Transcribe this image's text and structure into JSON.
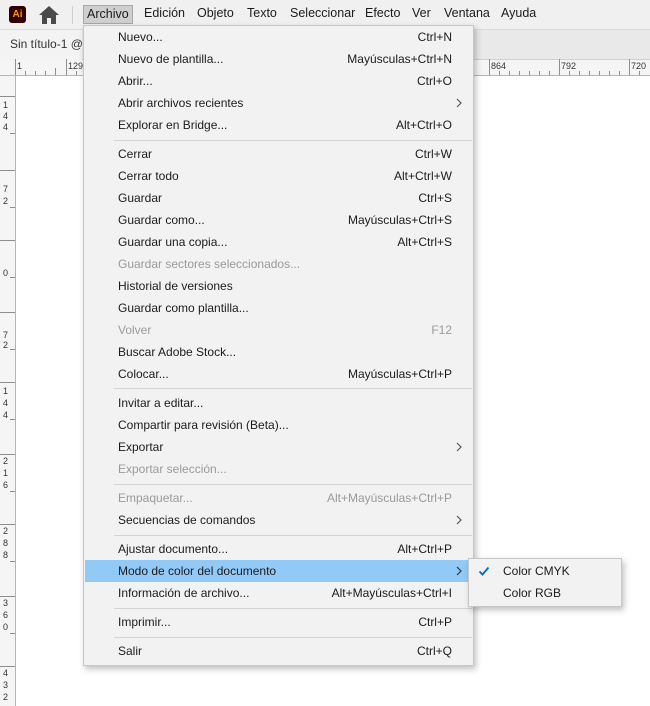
{
  "app": {
    "logo_text": "Ai"
  },
  "menubar": {
    "items": [
      "Archivo",
      "Edición",
      "Objeto",
      "Texto",
      "Seleccionar",
      "Efecto",
      "Ver",
      "Ventana",
      "Ayuda"
    ],
    "active_index": 0
  },
  "document_tab": {
    "title": "Sin título-1 @"
  },
  "ruler": {
    "top_labels": [
      "1",
      "129",
      "864",
      "792",
      "720"
    ],
    "left_labels": [
      [
        "1",
        "4",
        "4"
      ],
      [
        "7",
        "2"
      ],
      [
        "0"
      ],
      [
        "7",
        "2"
      ],
      [
        "1",
        "4",
        "4"
      ],
      [
        "2",
        "1",
        "6"
      ],
      [
        "2",
        "8",
        "8"
      ],
      [
        "3",
        "6",
        "0"
      ],
      [
        "4",
        "3",
        "2"
      ]
    ]
  },
  "file_menu": {
    "items": [
      {
        "label": "Nuevo...",
        "shortcut": "Ctrl+N"
      },
      {
        "label": "Nuevo de plantilla...",
        "shortcut": "Mayúsculas+Ctrl+N"
      },
      {
        "label": "Abrir...",
        "shortcut": "Ctrl+O"
      },
      {
        "label": "Abrir archivos recientes",
        "shortcut": "",
        "submenu": true
      },
      {
        "label": "Explorar en Bridge...",
        "shortcut": "Alt+Ctrl+O"
      },
      {
        "label": "Cerrar",
        "shortcut": "Ctrl+W"
      },
      {
        "label": "Cerrar todo",
        "shortcut": "Alt+Ctrl+W"
      },
      {
        "label": "Guardar",
        "shortcut": "Ctrl+S"
      },
      {
        "label": "Guardar como...",
        "shortcut": "Mayúsculas+Ctrl+S"
      },
      {
        "label": "Guardar una copia...",
        "shortcut": "Alt+Ctrl+S"
      },
      {
        "label": "Guardar sectores seleccionados...",
        "shortcut": "",
        "disabled": true
      },
      {
        "label": "Historial de versiones",
        "shortcut": ""
      },
      {
        "label": "Guardar como plantilla...",
        "shortcut": ""
      },
      {
        "label": "Volver",
        "shortcut": "F12",
        "disabled": true
      },
      {
        "label": "Buscar Adobe Stock...",
        "shortcut": ""
      },
      {
        "label": "Colocar...",
        "shortcut": "Mayúsculas+Ctrl+P"
      },
      {
        "label": "Invitar a editar...",
        "shortcut": ""
      },
      {
        "label": "Compartir para revisión (Beta)...",
        "shortcut": ""
      },
      {
        "label": "Exportar",
        "shortcut": "",
        "submenu": true
      },
      {
        "label": "Exportar selección...",
        "shortcut": "",
        "disabled": true
      },
      {
        "label": "Empaquetar...",
        "shortcut": "Alt+Mayúsculas+Ctrl+P",
        "disabled": true
      },
      {
        "label": "Secuencias de comandos",
        "shortcut": "",
        "submenu": true
      },
      {
        "label": "Ajustar documento...",
        "shortcut": "Alt+Ctrl+P"
      },
      {
        "label": "Modo de color del documento",
        "shortcut": "",
        "submenu": true,
        "highlighted": true
      },
      {
        "label": "Información de archivo...",
        "shortcut": "Alt+Mayúsculas+Ctrl+I"
      },
      {
        "label": "Imprimir...",
        "shortcut": "Ctrl+P"
      },
      {
        "label": "Salir",
        "shortcut": "Ctrl+Q"
      }
    ]
  },
  "color_mode_submenu": {
    "items": [
      {
        "label": "Color CMYK",
        "checked": true
      },
      {
        "label": "Color RGB",
        "checked": false
      }
    ]
  },
  "colors": {
    "highlight": "#91c9f7",
    "menu_background": "#f2f2f2",
    "disabled_text": "#9a9a9a",
    "app_logo_bg": "#330000",
    "app_logo_fg": "#ff9a00"
  }
}
